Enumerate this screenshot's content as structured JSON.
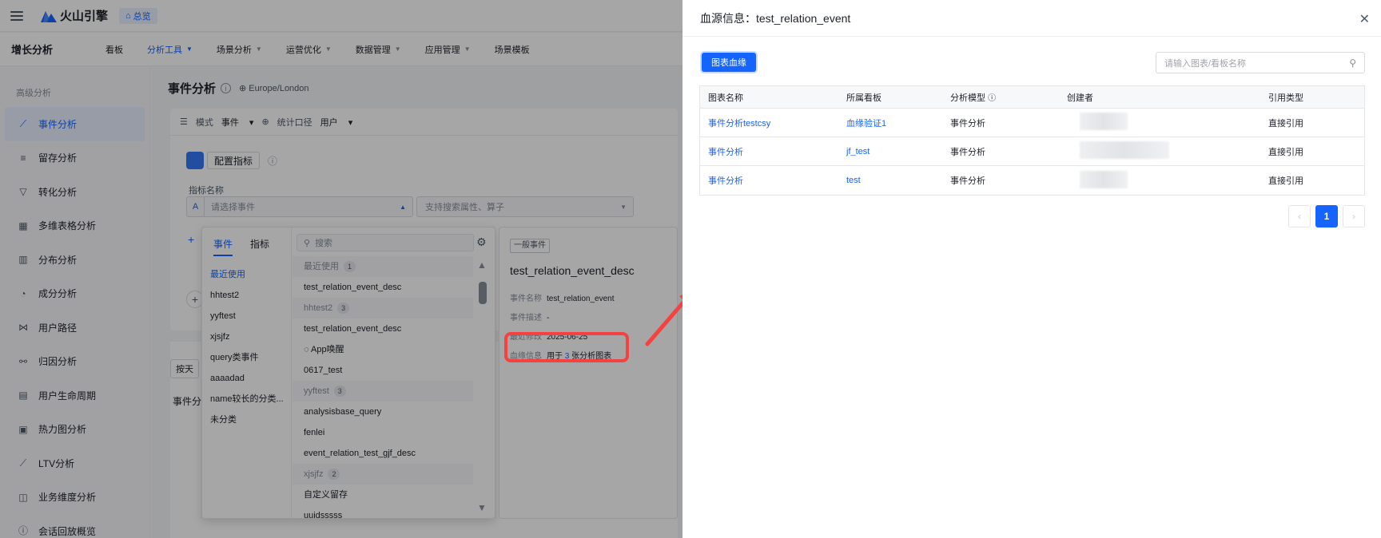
{
  "topbar": {
    "logo_text": "火山引擎",
    "overview": "总览"
  },
  "nav": {
    "brand": "增长分析",
    "items": [
      {
        "label": "看板",
        "caret": false,
        "active": false
      },
      {
        "label": "分析工具",
        "caret": true,
        "active": true
      },
      {
        "label": "场景分析",
        "caret": true,
        "active": false
      },
      {
        "label": "运营优化",
        "caret": true,
        "active": false
      },
      {
        "label": "数据管理",
        "caret": true,
        "active": false
      },
      {
        "label": "应用管理",
        "caret": true,
        "active": false
      },
      {
        "label": "场景模板",
        "caret": false,
        "active": false
      }
    ]
  },
  "sidebar": {
    "section": "高级分析",
    "items": [
      {
        "label": "事件分析",
        "icon": "line-chart-icon",
        "active": true
      },
      {
        "label": "留存分析",
        "icon": "bars-icon"
      },
      {
        "label": "转化分析",
        "icon": "funnel-icon"
      },
      {
        "label": "多维表格分析",
        "icon": "table-icon"
      },
      {
        "label": "分布分析",
        "icon": "bar-chart-icon"
      },
      {
        "label": "成分分析",
        "icon": "pie-icon"
      },
      {
        "label": "用户路径",
        "icon": "path-icon"
      },
      {
        "label": "归因分析",
        "icon": "attribution-icon"
      },
      {
        "label": "用户生命周期",
        "icon": "lifecycle-icon"
      },
      {
        "label": "热力图分析",
        "icon": "heatmap-icon"
      },
      {
        "label": "LTV分析",
        "icon": "ltv-icon"
      },
      {
        "label": "业务维度分析",
        "icon": "dimension-icon"
      },
      {
        "label": "会话回放概览",
        "icon": "info-icon"
      }
    ]
  },
  "main": {
    "title": "事件分析",
    "timezone": "Europe/London",
    "mode_label": "模式",
    "mode_value": "事件",
    "caliber_label": "统计口径",
    "caliber_value": "用户",
    "config_button": "配置指标",
    "metric_label": "指标名称",
    "event_select_placeholder": "请选择事件",
    "attr_select_placeholder": "支持搜索属性、算子",
    "by_day": "按天",
    "event_section": "事件分"
  },
  "dropdown": {
    "tabs": [
      "事件",
      "指标"
    ],
    "search_placeholder": "搜索",
    "categories": [
      "最近使用",
      "hhtest2",
      "yyftest",
      "xjsjfz",
      "query类事件",
      "aaaadad",
      "name较长的分类...",
      "未分类"
    ],
    "rows": [
      {
        "label": "最近使用",
        "group": true,
        "count": "1"
      },
      {
        "label": "test_relation_event_desc",
        "group": false
      },
      {
        "label": "hhtest2",
        "group": true,
        "count": "3"
      },
      {
        "label": "test_relation_event_desc",
        "group": false
      },
      {
        "label": "App唤醒",
        "group": false
      },
      {
        "label": "0617_test",
        "group": false
      },
      {
        "label": "yyftest",
        "group": true,
        "count": "3"
      },
      {
        "label": "analysisbase_query",
        "group": false
      },
      {
        "label": "fenlei",
        "group": false
      },
      {
        "label": "event_relation_test_gjf_desc",
        "group": false
      },
      {
        "label": "xjsjfz",
        "group": true,
        "count": "2"
      },
      {
        "label": "自定义留存",
        "group": false
      },
      {
        "label": "uuidsssss",
        "group": false
      }
    ]
  },
  "detail": {
    "tag": "一般事件",
    "title": "test_relation_event_desc",
    "name_label": "事件名称",
    "name_value": "test_relation_event",
    "desc_label": "事件描述",
    "desc_value": "-",
    "modified_label": "最近修改",
    "modified_value": "2025-06-25",
    "lineage_label": "血缘信息",
    "lineage_prefix": "用于",
    "lineage_count": "3",
    "lineage_suffix": "张分析图表"
  },
  "drawer": {
    "title": "血源信息：test_relation_event",
    "tab": "图表血缘",
    "search_placeholder": "请输入图表/看板名称",
    "columns": [
      "图表名称",
      "所属看板",
      "分析模型",
      "创建者",
      "引用类型"
    ],
    "rows": [
      {
        "chart": "事件分析testcsy",
        "board": "血缘验证1",
        "model": "事件分析",
        "ref": "直接引用"
      },
      {
        "chart": "事件分析",
        "board": "jf_test",
        "model": "事件分析",
        "ref": "直接引用"
      },
      {
        "chart": "事件分析",
        "board": "test",
        "model": "事件分析",
        "ref": "直接引用"
      }
    ],
    "pager": {
      "prev": "‹",
      "page": "1",
      "next": "›"
    }
  },
  "colors": {
    "accent": "#1664ff",
    "highlight": "#f5413f"
  }
}
